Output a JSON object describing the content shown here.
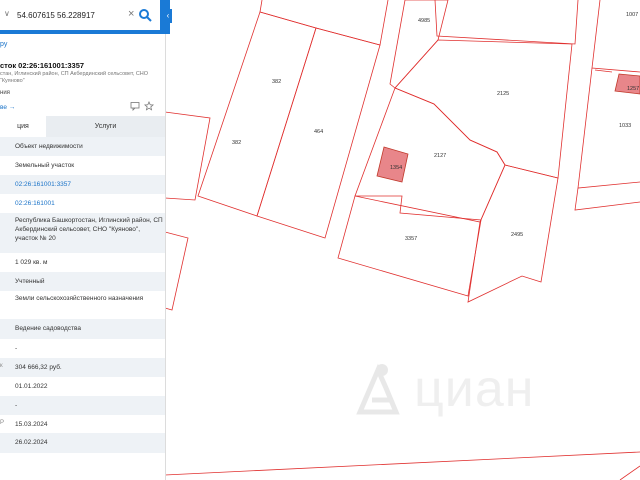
{
  "search": {
    "value": "54.607615 56.228917"
  },
  "panel": {
    "back_label": "ру",
    "title": "сток 02:26:161001:3357",
    "address": "стан, Иглинский район, СП Акбердинский сельсовет, СНО “Куяново”",
    "property_type": "ния",
    "more_link": "ве →",
    "tabs": {
      "active": "ция",
      "inactive": "Услуги"
    },
    "rows": [
      {
        "value": "Объект недвижимости",
        "link": false
      },
      {
        "value": "Земельный участок",
        "link": false
      },
      {
        "value": "02:26:161001:3357",
        "link": true
      },
      {
        "value": "02:26:161001",
        "link": true
      },
      {
        "value": "Республика Башкортостан, Иглинский район, СП Акбердинский сельсовет, СНО \"Куяново\", участок № 20",
        "link": false
      },
      {
        "value": "1 029 кв. м",
        "link": false
      },
      {
        "value": "Учтенный",
        "link": false
      },
      {
        "value": "Земли сельскохозяйственного назначения",
        "link": false
      },
      {
        "value": "Ведение садоводства",
        "link": false
      },
      {
        "value": "-",
        "link": false
      },
      {
        "value": "304 666,32 руб.",
        "link": false,
        "prefix": "к"
      },
      {
        "value": "01.01.2022",
        "link": false
      },
      {
        "value": "-",
        "link": false
      },
      {
        "value": "15.03.2024",
        "link": false,
        "prefix": "Р"
      },
      {
        "value": "26.02.2024",
        "link": false
      }
    ]
  },
  "map": {
    "plot_labels": [
      "4985",
      "1007",
      "382",
      "2125",
      "1257",
      "464",
      "1033",
      "382",
      "2127",
      "1354",
      "3357",
      "2495"
    ],
    "watermark": "циан",
    "colors": {
      "boundary": "#e0302f",
      "highlight_fill": "#e8868a",
      "accent": "#1a7ad6"
    }
  }
}
